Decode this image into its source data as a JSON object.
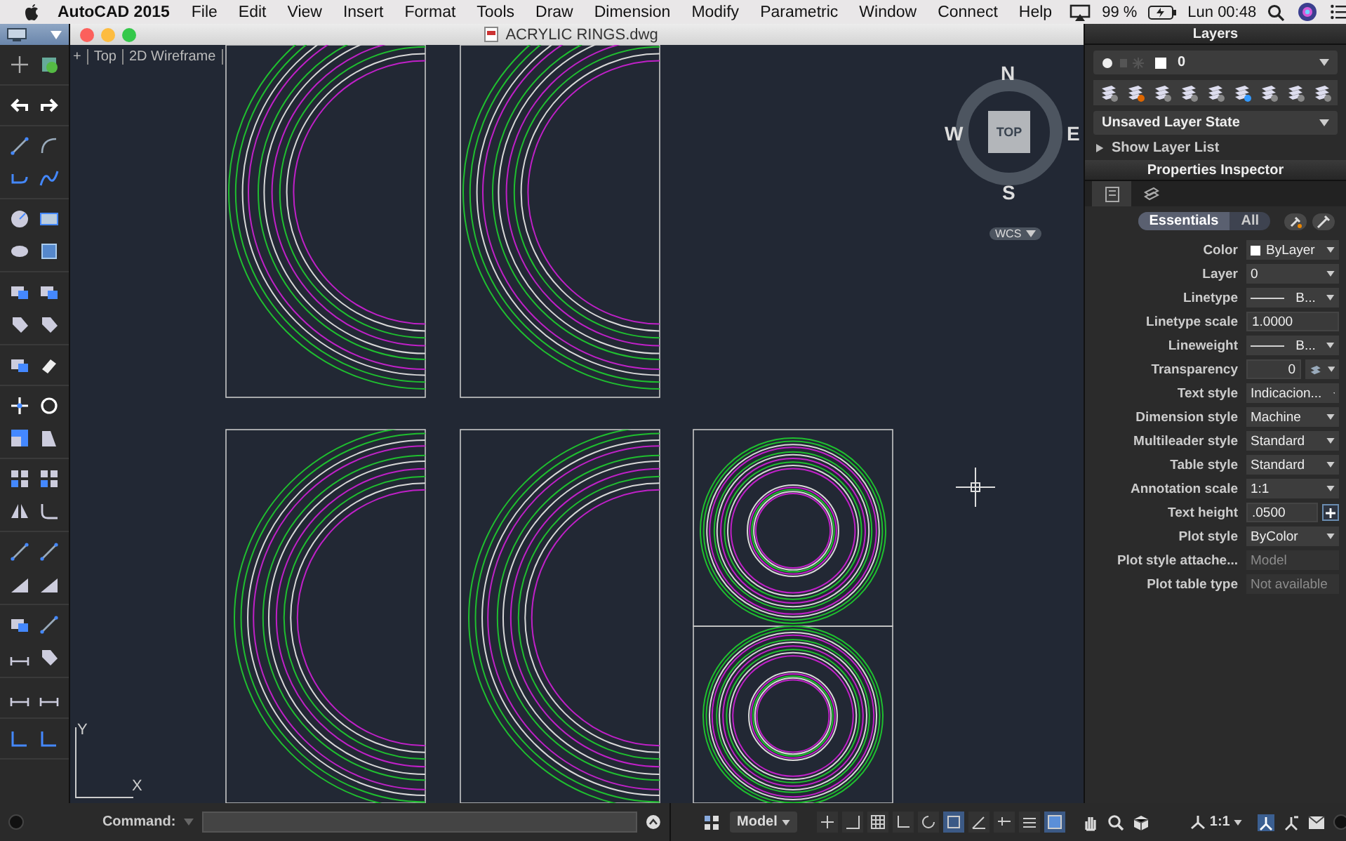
{
  "menu_bar": {
    "app_name": "AutoCAD 2015",
    "items": [
      "File",
      "Edit",
      "View",
      "Insert",
      "Format",
      "Tools",
      "Draw",
      "Dimension",
      "Modify",
      "Parametric",
      "Window",
      "Connect",
      "Help"
    ],
    "battery": "99 %",
    "clock": "Lun 00:48"
  },
  "window": {
    "title": "ACRYLIC RINGS.dwg"
  },
  "viewport": {
    "controls": [
      "+",
      "Top",
      "2D Wireframe"
    ]
  },
  "view_cube": {
    "face": "TOP",
    "north": "N",
    "south": "S",
    "east": "E",
    "west": "W",
    "coordinate_system": "WCS"
  },
  "ucs": {
    "x_axis": "X",
    "y_axis": "Y"
  },
  "layers_panel": {
    "title": "Layers",
    "current_layer": "0",
    "layer_state": "Unsaved Layer State",
    "show_layer_list": "Show Layer List",
    "expanded": false
  },
  "properties_inspector": {
    "title": "Properties Inspector",
    "tabs": [
      {
        "selected": true
      },
      {
        "selected": false
      }
    ],
    "filters": [
      {
        "label": "Essentials",
        "selected": true
      },
      {
        "label": "All",
        "selected": false
      }
    ],
    "properties": [
      {
        "label": "Color",
        "kind": "swatch",
        "value": "ByLayer"
      },
      {
        "label": "Layer",
        "kind": "select",
        "value": "0"
      },
      {
        "label": "Linetype",
        "kind": "line",
        "value": "B..."
      },
      {
        "label": "Linetype scale",
        "kind": "input",
        "value": "1.0000"
      },
      {
        "label": "Lineweight",
        "kind": "line",
        "value": "B..."
      },
      {
        "label": "Transparency",
        "kind": "transparency",
        "value": "0"
      },
      {
        "label": "Text style",
        "kind": "select",
        "value": "Indicacion..."
      },
      {
        "label": "Dimension style",
        "kind": "select",
        "value": "Machine"
      },
      {
        "label": "Multileader style",
        "kind": "select",
        "value": "Standard"
      },
      {
        "label": "Table style",
        "kind": "select",
        "value": "Standard"
      },
      {
        "label": "Annotation scale",
        "kind": "select",
        "value": "1:1"
      },
      {
        "label": "Text height",
        "kind": "input-button",
        "value": ".0500"
      },
      {
        "label": "Plot style",
        "kind": "select",
        "value": "ByColor"
      },
      {
        "label": "Plot style attache...",
        "kind": "readonly",
        "value": "Model"
      },
      {
        "label": "Plot table type",
        "kind": "readonly",
        "value": "Not available"
      }
    ]
  },
  "command_line": {
    "label": "Command:"
  },
  "status_bar": {
    "space": "Model",
    "annotation_scale": "1:1",
    "toggles": [
      {
        "on": false
      },
      {
        "on": false
      },
      {
        "on": false
      },
      {
        "on": false
      },
      {
        "on": false
      },
      {
        "on": true
      },
      {
        "on": false
      },
      {
        "on": false
      },
      {
        "on": false
      },
      {
        "on": true
      }
    ]
  }
}
